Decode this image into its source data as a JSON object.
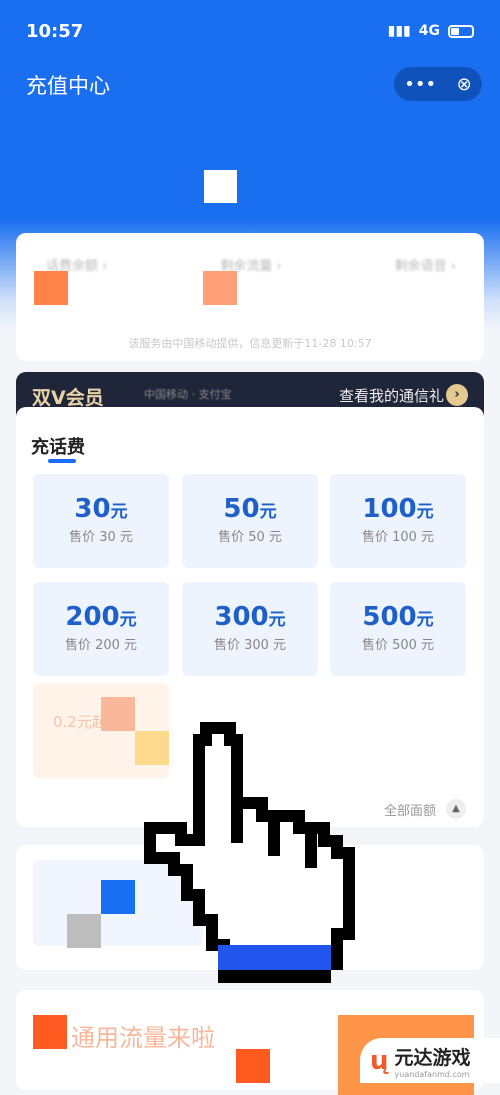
{
  "status": {
    "time": "10:57",
    "network": "4G"
  },
  "header": {
    "title": "充值中心",
    "more": "•••",
    "close": "⊗"
  },
  "balance": {
    "labels": [
      "话费余额 ›",
      "剩余流量 ›",
      "剩余语音 ›"
    ],
    "note": "该服务由中国移动提供，信息更新于11-28 10:57"
  },
  "vip": {
    "name": "双V会员",
    "partners": "中国移动 · 支付宝",
    "link": "查看我的通信礼",
    "arrow": "›"
  },
  "recharge": {
    "tab": "充话费",
    "tiles": [
      {
        "value": "30",
        "unit": "元",
        "price": "售价 30 元"
      },
      {
        "value": "50",
        "unit": "元",
        "price": "售价 50 元"
      },
      {
        "value": "100",
        "unit": "元",
        "price": "售价 100 元"
      },
      {
        "value": "200",
        "unit": "元",
        "price": "售价 200 元"
      },
      {
        "value": "300",
        "unit": "元",
        "price": "售价 300 元"
      },
      {
        "value": "500",
        "unit": "元",
        "price": "售价 500 元"
      }
    ],
    "promo": "0.2元起",
    "all": "全部面额"
  },
  "promo_banner": "通用流量来啦",
  "watermark": {
    "name": "元达游戏",
    "url": "yuandafanmd.com"
  },
  "colors": {
    "brand": "#1a6ff0",
    "vip_bg": "#20263a",
    "gold": "#e4c990"
  }
}
